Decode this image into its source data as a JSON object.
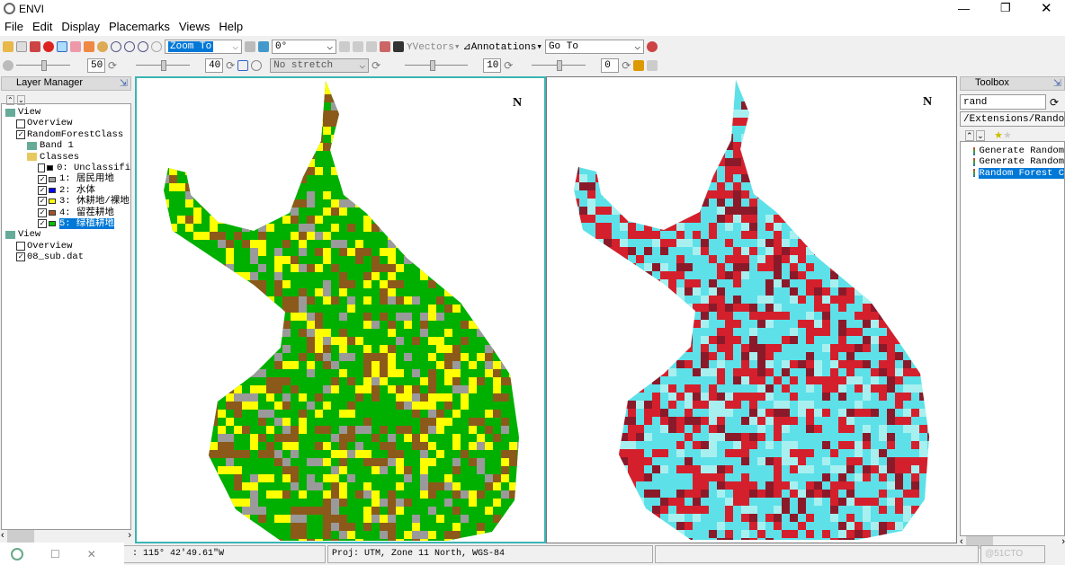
{
  "window": {
    "title": "ENVI"
  },
  "menu": [
    "File",
    "Edit",
    "Display",
    "Placemarks",
    "Views",
    "Help"
  ],
  "toolbar": {
    "zoom_to": "Zoom To",
    "rotation": "0°",
    "vectors": "Vectors",
    "annotations": "Annotations",
    "go_to": "Go To",
    "brightness": "50",
    "contrast": "40",
    "stretch": "No stretch",
    "sharpen": "10",
    "transparency": "0"
  },
  "layer_manager": {
    "title": "Layer Manager",
    "items": [
      {
        "label": "View",
        "level": 0,
        "checkbox": null
      },
      {
        "label": "Overview",
        "level": 1,
        "checkbox": false
      },
      {
        "label": "RandomForestClass",
        "level": 1,
        "checkbox": true
      },
      {
        "label": "Band 1",
        "level": 2,
        "checkbox": null
      },
      {
        "label": "Classes",
        "level": 2,
        "checkbox": null
      },
      {
        "label": "0: Unclassifi",
        "level": 3,
        "checkbox": false,
        "color": "#000000"
      },
      {
        "label": "1: 居民用地",
        "level": 3,
        "checkbox": true,
        "color": "#a0a0a0"
      },
      {
        "label": "2: 水体",
        "level": 3,
        "checkbox": true,
        "color": "#0000ff"
      },
      {
        "label": "3: 休耕地/裸地",
        "level": 3,
        "checkbox": true,
        "color": "#ffff00"
      },
      {
        "label": "4: 留茬耕地",
        "level": 3,
        "checkbox": true,
        "color": "#a0522d"
      },
      {
        "label": "5: 绿植耕地",
        "level": 3,
        "checkbox": true,
        "color": "#00c000",
        "selected": true
      },
      {
        "label": "View",
        "level": 0,
        "checkbox": null
      },
      {
        "label": "Overview",
        "level": 1,
        "checkbox": false
      },
      {
        "label": "08_sub.dat",
        "level": 1,
        "checkbox": true
      }
    ]
  },
  "toolbox": {
    "title": "Toolbox",
    "search": "rand",
    "path": "/Extensions/Random F",
    "items": [
      {
        "label": "Generate Random"
      },
      {
        "label": "Generate Random"
      },
      {
        "label": "Random Forest C",
        "selected": true
      }
    ]
  },
  "views": {
    "north_label": "N"
  },
  "status": {
    "coords": ": 115° 42′49.61″W",
    "proj": "Proj: UTM, Zone 11 North, WGS-84",
    "watermark": "@51CTO"
  },
  "colors": {
    "class_map": [
      "#00b000",
      "#ffff00",
      "#8b5a1a",
      "#9a9a9a",
      "#0000ff"
    ],
    "cir_map": [
      "#5ee0e8",
      "#d4202c",
      "#8a1a2a",
      "#a8f0f0"
    ],
    "view_border": "#3cb4b4",
    "selection": "#0078d7"
  }
}
